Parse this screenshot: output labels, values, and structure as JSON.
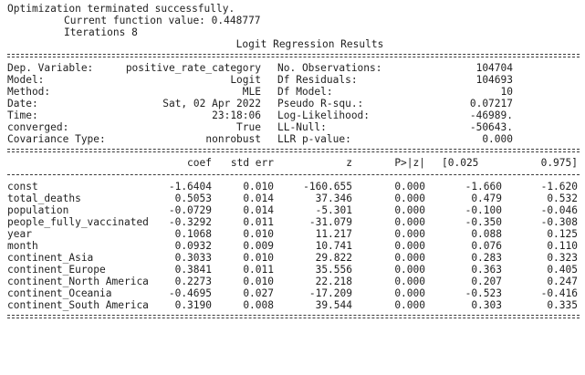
{
  "messages": {
    "line1": "Optimization terminated successfully.",
    "line2": "Current function value: 0.448777",
    "line3": "Iterations 8"
  },
  "title": "Logit Regression Results",
  "info": [
    {
      "label": "Dep. Variable:",
      "value": "positive_rate_category",
      "label2": "No. Observations:",
      "value2": "104704"
    },
    {
      "label": "Model:",
      "value": "Logit",
      "label2": "Df Residuals:",
      "value2": "104693"
    },
    {
      "label": "Method:",
      "value": "MLE",
      "label2": "Df Model:",
      "value2": "10"
    },
    {
      "label": "Date:",
      "value": "Sat, 02 Apr 2022",
      "label2": "Pseudo R-squ.:",
      "value2": "0.07217"
    },
    {
      "label": "Time:",
      "value": "23:18:06",
      "label2": "Log-Likelihood:",
      "value2": "-46989."
    },
    {
      "label": "converged:",
      "value": "True",
      "label2": "LL-Null:",
      "value2": "-50643."
    },
    {
      "label": "Covariance Type:",
      "value": "nonrobust",
      "label2": "LLR p-value:",
      "value2": "0.000"
    }
  ],
  "coef_header": {
    "coef": "coef",
    "std_err": "std err",
    "z": "z",
    "p": "P>|z|",
    "lo": "[0.025",
    "hi": "0.975]"
  },
  "coef_rows": [
    {
      "name": "const",
      "coef": "-1.6404",
      "std_err": "0.010",
      "z": "-160.655",
      "p": "0.000",
      "lo": "-1.660",
      "hi": "-1.620"
    },
    {
      "name": "total_deaths",
      "coef": "0.5053",
      "std_err": "0.014",
      "z": "37.346",
      "p": "0.000",
      "lo": "0.479",
      "hi": "0.532"
    },
    {
      "name": "population",
      "coef": "-0.0729",
      "std_err": "0.014",
      "z": "-5.301",
      "p": "0.000",
      "lo": "-0.100",
      "hi": "-0.046"
    },
    {
      "name": "people_fully_vaccinated",
      "coef": "-0.3292",
      "std_err": "0.011",
      "z": "-31.079",
      "p": "0.000",
      "lo": "-0.350",
      "hi": "-0.308"
    },
    {
      "name": "year",
      "coef": "0.1068",
      "std_err": "0.010",
      "z": "11.217",
      "p": "0.000",
      "lo": "0.088",
      "hi": "0.125"
    },
    {
      "name": "month",
      "coef": "0.0932",
      "std_err": "0.009",
      "z": "10.741",
      "p": "0.000",
      "lo": "0.076",
      "hi": "0.110"
    },
    {
      "name": "continent_Asia",
      "coef": "0.3033",
      "std_err": "0.010",
      "z": "29.822",
      "p": "0.000",
      "lo": "0.283",
      "hi": "0.323"
    },
    {
      "name": "continent_Europe",
      "coef": "0.3841",
      "std_err": "0.011",
      "z": "35.556",
      "p": "0.000",
      "lo": "0.363",
      "hi": "0.405"
    },
    {
      "name": "continent_North America",
      "coef": "0.2273",
      "std_err": "0.010",
      "z": "22.218",
      "p": "0.000",
      "lo": "0.207",
      "hi": "0.247"
    },
    {
      "name": "continent_Oceania",
      "coef": "-0.4695",
      "std_err": "0.027",
      "z": "-17.209",
      "p": "0.000",
      "lo": "-0.523",
      "hi": "-0.416"
    },
    {
      "name": "continent_South America",
      "coef": "0.3190",
      "std_err": "0.008",
      "z": "39.544",
      "p": "0.000",
      "lo": "0.303",
      "hi": "0.335"
    }
  ]
}
